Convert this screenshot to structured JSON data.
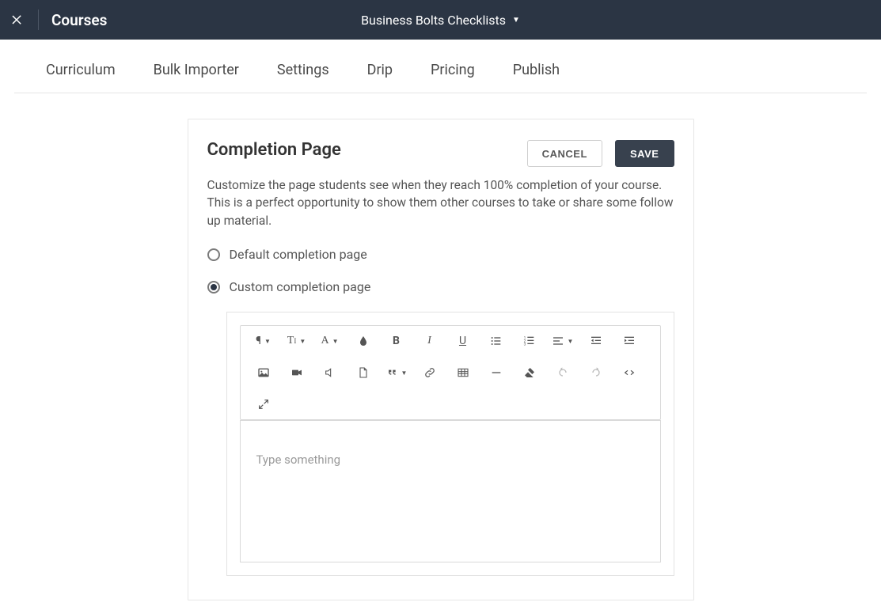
{
  "header": {
    "section": "Courses",
    "course_name": "Business Bolts Checklists"
  },
  "tabs": [
    "Curriculum",
    "Bulk Importer",
    "Settings",
    "Drip",
    "Pricing",
    "Publish"
  ],
  "panel": {
    "title": "Completion Page",
    "cancel": "CANCEL",
    "save": "SAVE",
    "description": "Customize the page students see when they reach 100% completion of your course. This is a perfect opportunity to show them other courses to take or share some follow up material.",
    "options": {
      "default": "Default completion page",
      "custom": "Custom completion page"
    },
    "editor_placeholder": "Type something"
  }
}
